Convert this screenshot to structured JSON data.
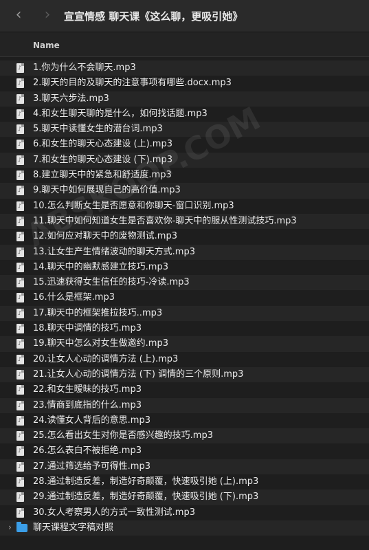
{
  "window": {
    "title": "宣宣情感 聊天课《这么聊，更吸引她》"
  },
  "header": {
    "name_col": "Name"
  },
  "files": [
    "1.你为什么不会聊天.mp3",
    "2.聊天的目的及聊天的注意事项有哪些.docx.mp3",
    "3.聊天六步法.mp3",
    "4.和女生聊天聊的是什么，如何找话题.mp3",
    "5.聊天中读懂女生的潜台词.mp3",
    "6.和女生的聊天心态建设 (上).mp3",
    "7.和女生的聊天心态建设 (下).mp3",
    "8.建立聊天中的紧急和舒适度.mp3",
    "9.聊天中如何展现自己的高价值.mp3",
    "10.怎么判断女生是否愿意和你聊天-窗口识别.mp3",
    "11.聊天中如何知道女生是否喜欢你-聊天中的服从性测试技巧.mp3",
    "12.如何应对聊天中的废物测试.mp3",
    "13.让女生产生情绪波动的聊天方式.mp3",
    "14.聊天中的幽默感建立技巧.mp3",
    "15.迅速获得女生信任的技巧-冷读.mp3",
    "16.什么是框架.mp3",
    "17.聊天中的框架推拉技巧..mp3",
    "18.聊天中调情的技巧.mp3",
    "19.聊天中怎么对女生做邀约.mp3",
    "20.让女人心动的调情方法 (上).mp3",
    "21.让女人心动的调情方法 (下) 调情的三个原则.mp3",
    "22.和女生暧昧的技巧.mp3",
    "23.情商到底指的什么.mp3",
    "24.读懂女人背后的意思.mp3",
    "25.怎么看出女生对你是否感兴趣的技巧.mp3",
    "26.怎么表白不被拒绝.mp3",
    "27.通过筛选给予可得性.mp3",
    "28.通过制造反差，制造好奇颠覆，快速吸引她 (上).mp3",
    "29.通过制造反差，制造好奇颠覆，快速吸引她 (下).mp3",
    "30.女人考察男人的方式一致性测试.mp3"
  ],
  "folder": {
    "label": "聊天课程文字稿对照"
  },
  "watermark": "ABSKOOP.COM"
}
